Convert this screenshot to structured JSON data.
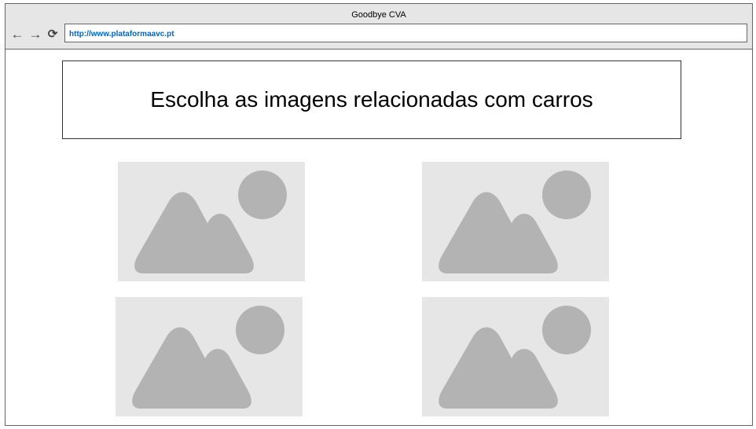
{
  "browser": {
    "window_title": "Goodbye CVA",
    "url": "http://www.plataformaavc.pt",
    "nav": {
      "back_icon": "arrow-left-icon",
      "forward_icon": "arrow-right-icon",
      "reload_icon": "reload-icon"
    }
  },
  "page": {
    "heading": "Escolha as imagens relacionadas com carros",
    "images": [
      {
        "icon": "image-placeholder-icon"
      },
      {
        "icon": "image-placeholder-icon"
      },
      {
        "icon": "image-placeholder-icon"
      },
      {
        "icon": "image-placeholder-icon"
      }
    ]
  },
  "colors": {
    "chrome_bg": "#e6e6e6",
    "placeholder_bg": "#e6e6e6",
    "placeholder_fg": "#b3b3b3",
    "url_text": "#0066cc",
    "border": "#666666"
  }
}
